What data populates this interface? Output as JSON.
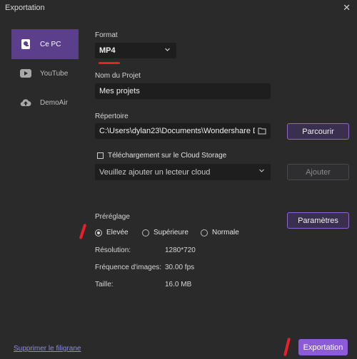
{
  "window": {
    "title": "Exportation",
    "close_glyph": "✕"
  },
  "sidebar": {
    "items": [
      {
        "label": "Ce PC",
        "icon": "pc-icon",
        "active": true
      },
      {
        "label": "YouTube",
        "icon": "youtube-icon",
        "active": false
      },
      {
        "label": "DemoAir",
        "icon": "cloud-upload-icon",
        "active": false
      }
    ]
  },
  "format": {
    "label": "Format",
    "value": "MP4"
  },
  "project": {
    "label": "Nom du Projet",
    "value": "Mes projets"
  },
  "directory": {
    "label": "Répertoire",
    "value": "C:\\Users\\dylan23\\Documents\\Wondershare D...",
    "browse_label": "Parcourir"
  },
  "cloud": {
    "checkbox_label": "Téléchargement sur le Cloud Storage",
    "checked": false,
    "placeholder": "Veuillez ajouter un lecteur cloud",
    "add_label": "Ajouter"
  },
  "preset": {
    "label": "Préréglage",
    "params_label": "Paramètres",
    "options": [
      {
        "label": "Elevée",
        "selected": true
      },
      {
        "label": "Supérieure",
        "selected": false
      },
      {
        "label": "Normale",
        "selected": false
      }
    ],
    "resolution_label": "Résolution:",
    "resolution_value": "1280*720",
    "framerate_label": "Fréquence d'images:",
    "framerate_value": "30.00 fps",
    "size_label": "Taille:",
    "size_value": "16.0 MB"
  },
  "footer": {
    "watermark_link": "Supprimer le filigrane",
    "export_label": "Exportation"
  },
  "colors": {
    "accent": "#8b5cd6",
    "active_sidebar": "#5b3f8c",
    "annotation_red": "#e8202a"
  }
}
